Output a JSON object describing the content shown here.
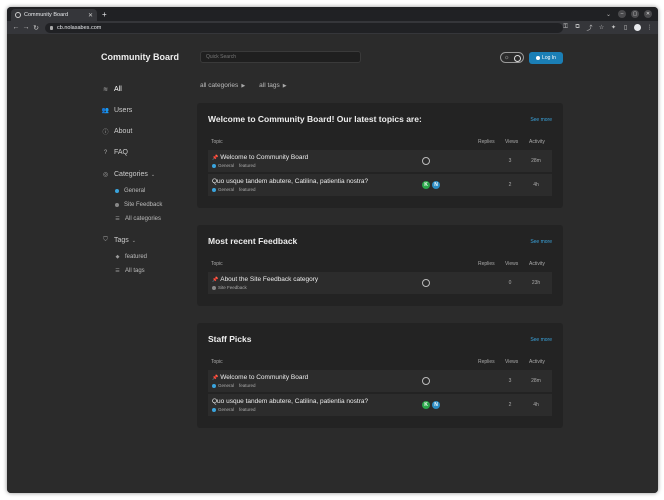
{
  "browser": {
    "tab_title": "Community Board",
    "url": "cb.nolasabes.com"
  },
  "header": {
    "site_title": "Community Board",
    "search_placeholder": "Quick Search",
    "login_label": "Log In"
  },
  "sidebar": {
    "all": "All",
    "users": "Users",
    "about": "About",
    "faq": "FAQ",
    "categories_label": "Categories",
    "categories": [
      {
        "label": "General",
        "color": "#3aa4dd"
      },
      {
        "label": "Site Feedback",
        "color": "#888888"
      },
      {
        "label": "All categories"
      }
    ],
    "tags_label": "Tags",
    "tags": [
      {
        "label": "featured"
      },
      {
        "label": "All tags"
      }
    ]
  },
  "filters": {
    "categories": "all categories",
    "tags": "all tags"
  },
  "columns": {
    "topic": "Topic",
    "replies": "Replies",
    "views": "Views",
    "activity": "Activity"
  },
  "see_more": "See more",
  "cards": [
    {
      "title": "Welcome to Community Board! Our latest topics are:",
      "rows": [
        {
          "title": "Welcome to Community Board",
          "category": "General",
          "tag": "featured",
          "replies": "",
          "views": "3",
          "activity": "28m"
        },
        {
          "title": "Quo usque tandem abutere, Catilina, patientia nostra?",
          "category": "General",
          "tag": "featured",
          "replies": "",
          "views": "2",
          "activity": "4h",
          "avatars": [
            "K",
            "N"
          ]
        }
      ]
    },
    {
      "title": "Most recent Feedback",
      "rows": [
        {
          "title": "About the Site Feedback category",
          "category": "Site Feedback",
          "tag": "",
          "replies": "",
          "views": "0",
          "activity": "23h"
        }
      ]
    },
    {
      "title": "Staff Picks",
      "rows": [
        {
          "title": "Welcome to Community Board",
          "category": "General",
          "tag": "featured",
          "replies": "",
          "views": "3",
          "activity": "28m"
        },
        {
          "title": "Quo usque tandem abutere, Catilina, patientia nostra?",
          "category": "General",
          "tag": "featured",
          "replies": "",
          "views": "2",
          "activity": "4h",
          "avatars": [
            "K",
            "N"
          ]
        }
      ]
    }
  ],
  "colors": {
    "accent": "#1b7fb6",
    "link": "#3aa4dd",
    "avatar_k": "#2aa84a",
    "avatar_n": "#2b8cc4"
  }
}
